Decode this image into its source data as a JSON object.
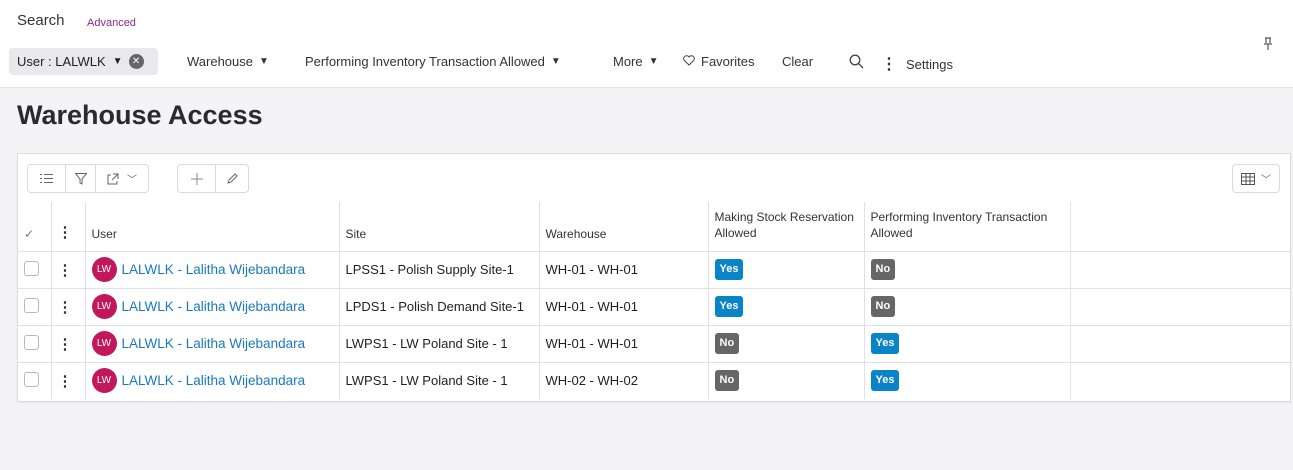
{
  "search": {
    "title": "Search",
    "advanced": "Advanced",
    "pin_icon": "pin-icon"
  },
  "filters": {
    "user_chip": "User : LALWLK",
    "warehouse": "Warehouse",
    "performing": "Performing Inventory Transaction Allowed",
    "more": "More",
    "favorites": "Favorites",
    "clear": "Clear",
    "settings": "Settings"
  },
  "page": {
    "title": "Warehouse Access"
  },
  "toolbar": {
    "icons": [
      "list-icon",
      "filter-icon",
      "export-icon",
      "add-icon",
      "edit-icon",
      "table-view-icon"
    ]
  },
  "table": {
    "columns": {
      "user": "User",
      "site": "Site",
      "warehouse": "Warehouse",
      "making_stock": "Making Stock Reservation Allowed",
      "performing": "Performing Inventory Transaction Allowed"
    },
    "rows": [
      {
        "avatar": "LW",
        "user": "LALWLK - Lalitha Wijebandara",
        "site": "LPSS1 - Polish Supply Site-1",
        "warehouse": "WH-01 - WH-01",
        "making_stock": "Yes",
        "performing": "No"
      },
      {
        "avatar": "LW",
        "user": "LALWLK - Lalitha Wijebandara",
        "site": "LPDS1 - Polish Demand Site-1",
        "warehouse": "WH-01 - WH-01",
        "making_stock": "Yes",
        "performing": "No"
      },
      {
        "avatar": "LW",
        "user": "LALWLK - Lalitha Wijebandara",
        "site": "LWPS1 - LW Poland Site - 1",
        "warehouse": "WH-01 - WH-01",
        "making_stock": "No",
        "performing": "Yes"
      },
      {
        "avatar": "LW",
        "user": "LALWLK - Lalitha Wijebandara",
        "site": "LWPS1 - LW Poland Site - 1",
        "warehouse": "WH-02 - WH-02",
        "making_stock": "No",
        "performing": "Yes"
      }
    ]
  },
  "colors": {
    "yes_badge": "#0b83c9",
    "no_badge": "#666666",
    "avatar": "#c2185b",
    "link": "#1a78c2",
    "advanced": "#8a2a8f"
  }
}
